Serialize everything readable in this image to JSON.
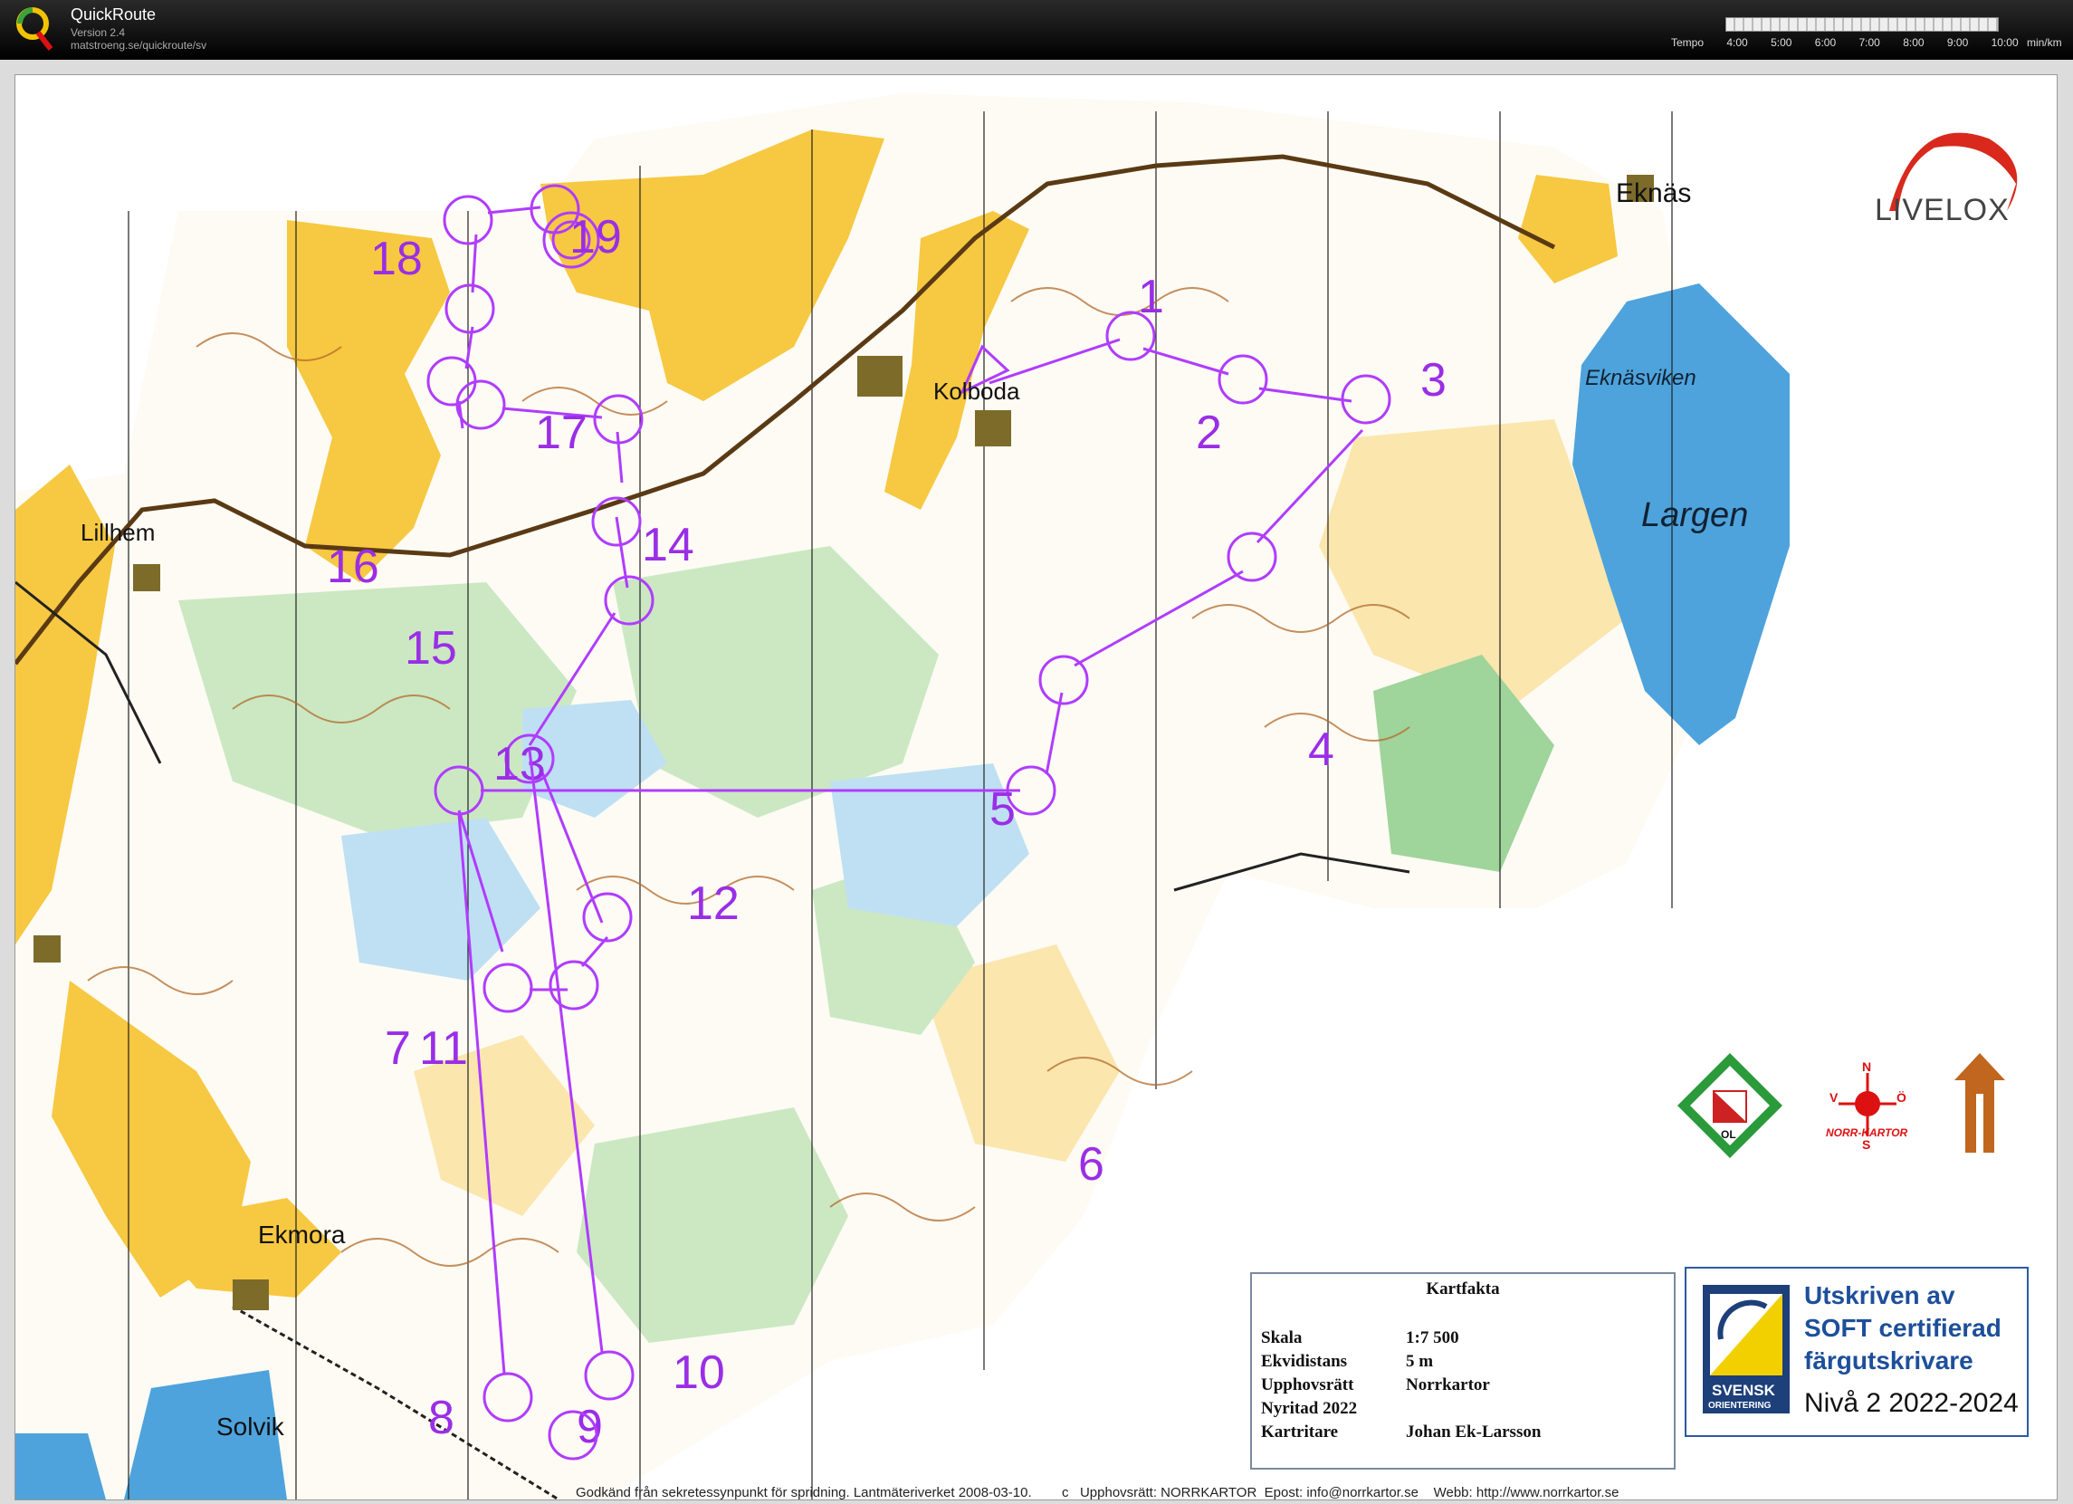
{
  "app": {
    "name": "QuickRoute",
    "version": "Version 2.4",
    "url": "matstroeng.se/quickroute/sv"
  },
  "tempo": {
    "label": "Tempo",
    "ticks": [
      "4:00",
      "5:00",
      "6:00",
      "7:00",
      "8:00",
      "9:00",
      "10:00"
    ],
    "unit": "min/km"
  },
  "map": {
    "livelox": "LIVELOX",
    "places": {
      "eknas": "Eknäs",
      "eknasviken": "Eknäsviken",
      "largen": "Largen",
      "kolboda": "Kolboda",
      "lillhem": "Lillhem",
      "ekmora": "Ekmora",
      "solvik": "Solvik"
    },
    "controls": [
      "1",
      "2",
      "3",
      "4",
      "5",
      "6",
      "7",
      "8",
      "9",
      "10",
      "11",
      "12",
      "13",
      "14",
      "15",
      "16",
      "17",
      "18",
      "19"
    ],
    "colors": {
      "course": "#b03cff",
      "water": "#4ea3dc",
      "open": "#f7c841",
      "forest": "#ffffff",
      "green": "#8fd08a",
      "contour": "#b2692a"
    }
  },
  "kartfakta": {
    "title": "Kartfakta",
    "rows": [
      {
        "key": "Skala",
        "value": "1:7 500"
      },
      {
        "key": "Ekvidistans",
        "value": "5 m"
      },
      {
        "key": "Upphovsrätt",
        "value": "Norrkartor"
      },
      {
        "key": "Nyritad 2022",
        "value": ""
      },
      {
        "key": "Kartritare",
        "value": "Johan Ek-Larsson"
      }
    ]
  },
  "soft": {
    "line1": "Utskriven av",
    "line2": "SOFT certifierad",
    "line3": "färgutskrivare",
    "line4": "Nivå 2 2022-2024",
    "logo_text1": "SVENSK",
    "logo_text2": "ORIENTERING"
  },
  "logos": {
    "vol": "OL",
    "norrkartor": "NORR-KARTOR"
  },
  "footer": "Godkänd från sekretessynpunkt för spridning. Lantmäteriverket 2008-03-10.        c   Upphovsrätt: NORRKARTOR  Epost: info@norrkartor.se    Webb: http://www.norrkartor.se"
}
